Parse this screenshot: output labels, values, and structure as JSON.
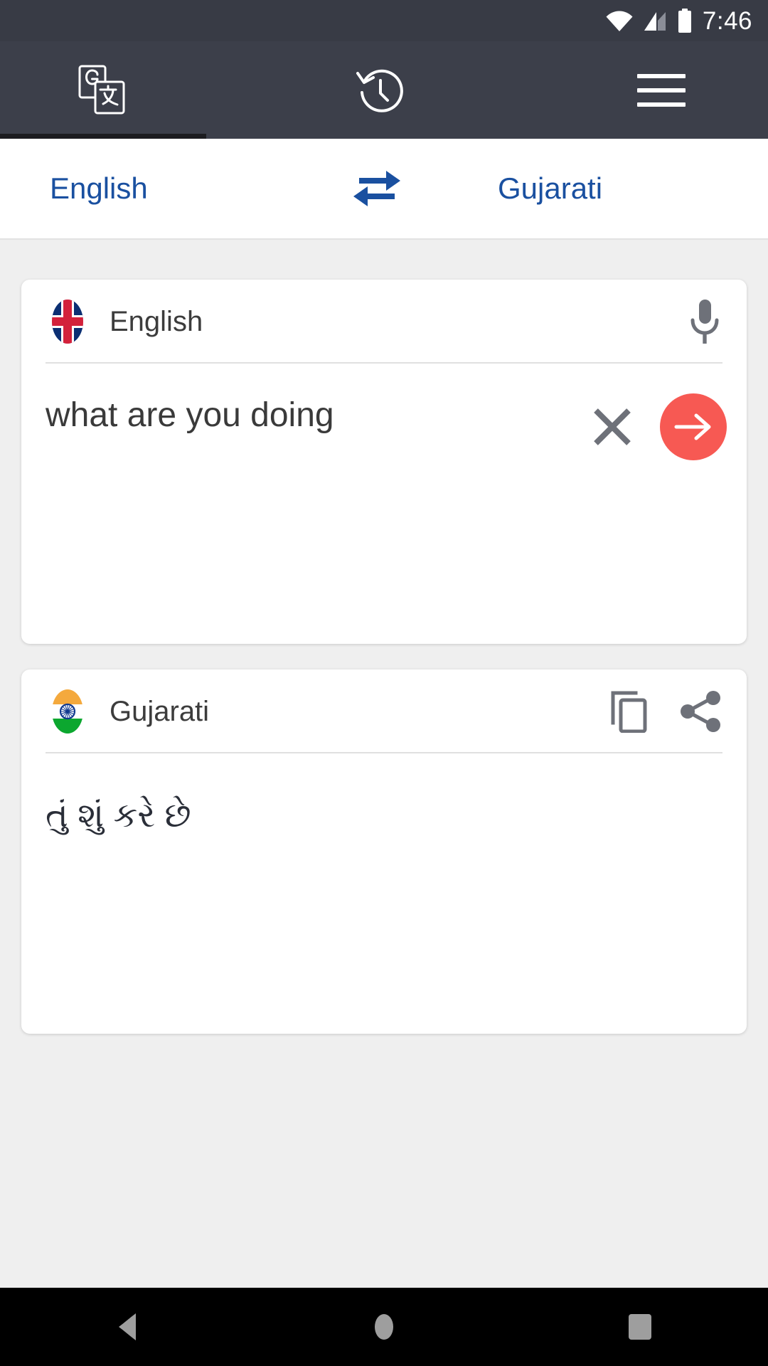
{
  "status_bar": {
    "time": "7:46",
    "icons": [
      "wifi-icon",
      "cellular-signal-icon",
      "battery-icon"
    ],
    "background": "#383B45"
  },
  "app_bar": {
    "background": "#3C3F4A",
    "active_tab_index": 0,
    "tabs": [
      {
        "name": "translate-tab",
        "icon": "google-translate-icon",
        "active": true
      },
      {
        "name": "history-tab",
        "icon": "history-icon",
        "active": false
      },
      {
        "name": "menu-button",
        "icon": "hamburger-menu-icon",
        "active": false
      }
    ]
  },
  "language_bar": {
    "source_language": "English",
    "target_language": "Gujarati",
    "swap_icon": "swap-horizontal-icon",
    "accent_color": "#1A50A0"
  },
  "source_card": {
    "flag": "united-kingdom-flag",
    "language": "English",
    "mic_icon": "microphone-icon",
    "text": "what are you doing",
    "clear_icon": "close-icon",
    "submit_icon": "arrow-right-icon",
    "submit_color": "#F75953"
  },
  "target_card": {
    "flag": "india-flag",
    "language": "Gujarati",
    "copy_icon": "copy-icon",
    "share_icon": "share-icon",
    "text": "તું શું કરે છે"
  },
  "nav_bar": {
    "background": "#000000",
    "buttons": [
      {
        "name": "back-button",
        "icon": "back-triangle-icon"
      },
      {
        "name": "home-button",
        "icon": "home-circle-icon"
      },
      {
        "name": "recents-button",
        "icon": "recents-square-icon"
      }
    ]
  }
}
